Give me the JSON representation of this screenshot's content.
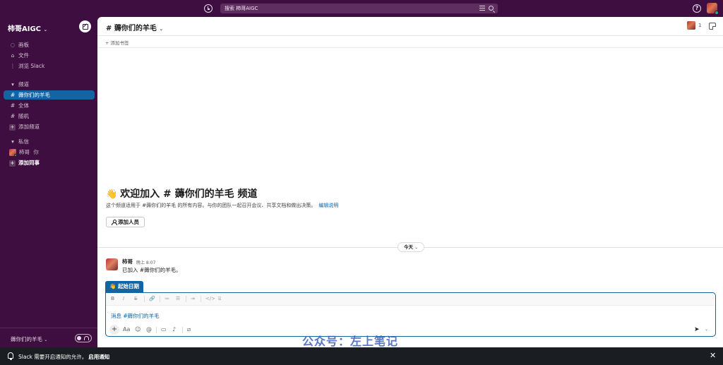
{
  "topbar": {
    "search_text": "搜索 柿哥AIGC",
    "help_label": "?"
  },
  "sidebar": {
    "workspace_name": "柿哥AIGC",
    "workspace_chevron": "⌄",
    "top_items": [
      {
        "icon": "◌",
        "label": "画板"
      },
      {
        "icon": "⌂",
        "label": "文件"
      },
      {
        "icon": "⋮",
        "label": "浏览 Slack"
      }
    ],
    "channels_section": "频道",
    "channels": [
      {
        "icon": "#",
        "label": "薅你们的羊毛",
        "active": true
      },
      {
        "icon": "#",
        "label": "全体"
      },
      {
        "icon": "#",
        "label": "随机"
      }
    ],
    "add_channel": "添加频道",
    "dm_section": "私信",
    "dm_user": "柿哥",
    "dm_you": "你",
    "add_colleague": "添加同事",
    "huddle_channel": "薅你们的羊毛",
    "huddle_chevron": "⌄"
  },
  "channel": {
    "title": "# 薅你们的羊毛",
    "chevron": "⌄",
    "member_count": "1",
    "add_bookmark": "+ 添加书签",
    "welcome_emoji": "👋",
    "welcome_title": "欢迎加入 # 薅你们的羊毛 频道",
    "welcome_desc": "这个频道适用于 #薅你们的羊毛 的所有内容。与你的团队一起召开会议、共享文档和做出决策。",
    "edit_desc": "编辑说明",
    "add_people": "添加人员",
    "day_label": "今天",
    "day_chevron": "⌄"
  },
  "message": {
    "author": "柿哥",
    "time": "晚上 8:07",
    "text": "已加入 #薅你们的羊毛。"
  },
  "composer": {
    "draft_tab": "👋 起始日期",
    "placeholder": "消息 #薅你们的羊毛",
    "plus": "+",
    "format_buttons": [
      "B",
      "I",
      "S",
      "🔗",
      "≔",
      "☰",
      "⇥",
      "</>",
      "⌸"
    ],
    "bottom_buttons": [
      "Aa",
      "☺",
      "@",
      "▭",
      "♪",
      "⧄"
    ],
    "send": "➤",
    "send_chevron": "⌄"
  },
  "watermark": "公众号：左上笔记",
  "notification": {
    "text": "Slack 需要开启通知的允许。",
    "link": "启用通知",
    "close": "✕"
  }
}
